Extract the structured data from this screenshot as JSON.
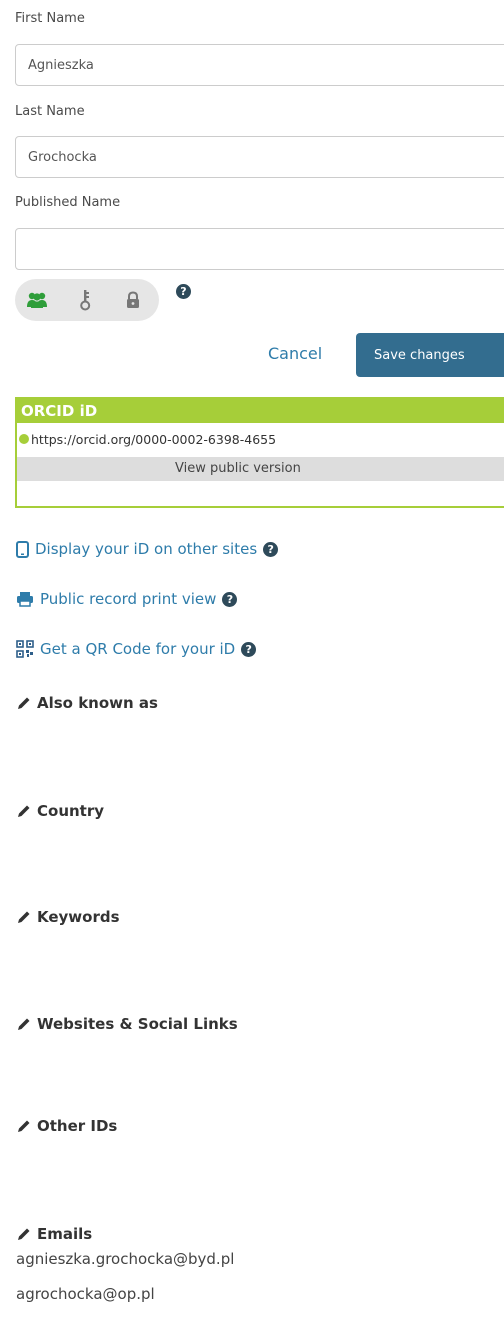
{
  "form": {
    "first_name_label": "First Name",
    "first_name_value": "Agnieszka",
    "last_name_label": "Last Name",
    "last_name_value": "Grochocka",
    "published_name_label": "Published Name",
    "published_name_value": ""
  },
  "privacy": {
    "options": [
      "everyone-icon",
      "key-icon",
      "lock-icon"
    ],
    "selected": "everyone",
    "help": "?"
  },
  "actions": {
    "cancel_label": "Cancel",
    "save_label": "Save changes"
  },
  "orcid": {
    "title": "ORCID iD",
    "url": "https://orcid.org/0000-0002-6398-4655",
    "view_public": "View public version",
    "accent_color": "#a6ce39"
  },
  "links": {
    "display_id": "Display your iD on other sites",
    "print_view": "Public record print view",
    "qr_code": "Get a QR Code for your iD"
  },
  "sections": {
    "also_known_as": "Also known as",
    "country": "Country",
    "keywords": "Keywords",
    "websites": "Websites & Social Links",
    "other_ids": "Other IDs",
    "emails": "Emails"
  },
  "emails": [
    "agnieszka.grochocka@byd.pl",
    "agrochocka@op.pl"
  ],
  "colors": {
    "link": "#2e7caa",
    "primary_button": "#336d8f",
    "privacy_active": "#2f9e3a"
  }
}
